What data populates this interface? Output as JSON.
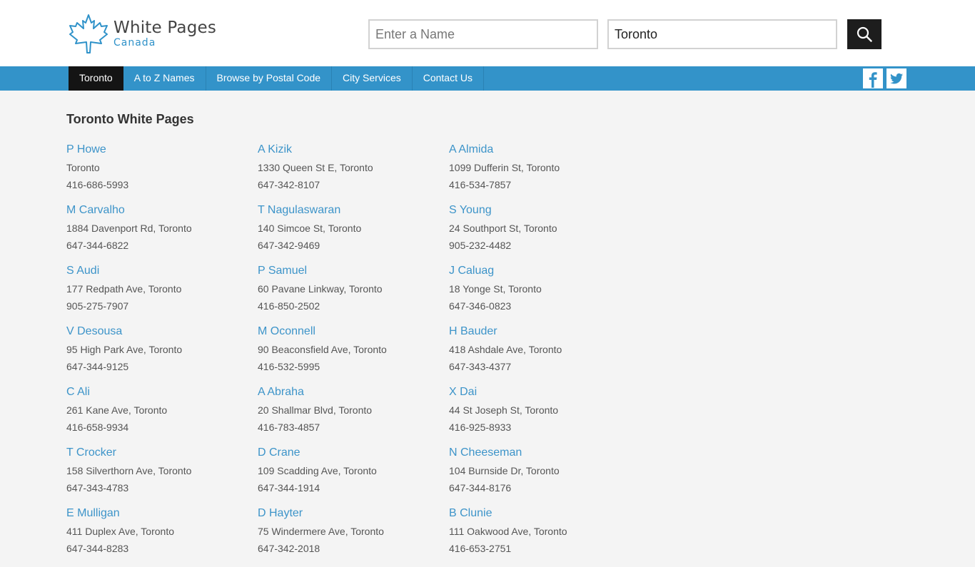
{
  "logo": {
    "title": "White Pages",
    "subtitle": "Canada",
    "icon": "maple-leaf-icon",
    "color": "#2f92c9"
  },
  "search": {
    "name_placeholder": "Enter a Name",
    "name_value": "",
    "city_value": "Toronto",
    "button_icon": "search-icon"
  },
  "nav": {
    "items": [
      {
        "label": "Toronto",
        "active": true
      },
      {
        "label": "A to Z Names",
        "active": false
      },
      {
        "label": "Browse by Postal Code",
        "active": false
      },
      {
        "label": "City Services",
        "active": false
      },
      {
        "label": "Contact Us",
        "active": false
      }
    ],
    "social": [
      "facebook-icon",
      "twitter-icon"
    ],
    "bar_color": "#3393c9",
    "active_color": "#141414"
  },
  "main": {
    "title": "Toronto White Pages",
    "entries": [
      {
        "name": "P Howe",
        "address": "Toronto",
        "phone": "416-686-5993"
      },
      {
        "name": "A Kizik",
        "address": "1330 Queen St E, Toronto",
        "phone": "647-342-8107"
      },
      {
        "name": "A Almida",
        "address": "1099 Dufferin St, Toronto",
        "phone": "416-534-7857"
      },
      {
        "name": "M Carvalho",
        "address": "1884 Davenport Rd, Toronto",
        "phone": "647-344-6822"
      },
      {
        "name": "T Nagulaswaran",
        "address": "140 Simcoe St, Toronto",
        "phone": "647-342-9469"
      },
      {
        "name": "S Young",
        "address": "24 Southport St, Toronto",
        "phone": "905-232-4482"
      },
      {
        "name": "S Audi",
        "address": "177 Redpath Ave, Toronto",
        "phone": "905-275-7907"
      },
      {
        "name": "P Samuel",
        "address": "60 Pavane Linkway, Toronto",
        "phone": "416-850-2502"
      },
      {
        "name": "J Caluag",
        "address": "18 Yonge St, Toronto",
        "phone": "647-346-0823"
      },
      {
        "name": "V Desousa",
        "address": "95 High Park Ave, Toronto",
        "phone": "647-344-9125"
      },
      {
        "name": "M Oconnell",
        "address": "90 Beaconsfield Ave, Toronto",
        "phone": "416-532-5995"
      },
      {
        "name": "H Bauder",
        "address": "418 Ashdale Ave, Toronto",
        "phone": "647-343-4377"
      },
      {
        "name": "C Ali",
        "address": "261 Kane Ave, Toronto",
        "phone": "416-658-9934"
      },
      {
        "name": "A Abraha",
        "address": "20 Shallmar Blvd, Toronto",
        "phone": "416-783-4857"
      },
      {
        "name": "X Dai",
        "address": "44 St Joseph St, Toronto",
        "phone": "416-925-8933"
      },
      {
        "name": "T Crocker",
        "address": "158 Silverthorn Ave, Toronto",
        "phone": "647-343-4783"
      },
      {
        "name": "D Crane",
        "address": "109 Scadding Ave, Toronto",
        "phone": "647-344-1914"
      },
      {
        "name": "N Cheeseman",
        "address": "104 Burnside Dr, Toronto",
        "phone": "647-344-8176"
      },
      {
        "name": "E Mulligan",
        "address": "411 Duplex Ave, Toronto",
        "phone": "647-344-8283"
      },
      {
        "name": "D Hayter",
        "address": "75 Windermere Ave, Toronto",
        "phone": "647-342-2018"
      },
      {
        "name": "B Clunie",
        "address": "111 Oakwood Ave, Toronto",
        "phone": "416-653-2751"
      }
    ]
  }
}
